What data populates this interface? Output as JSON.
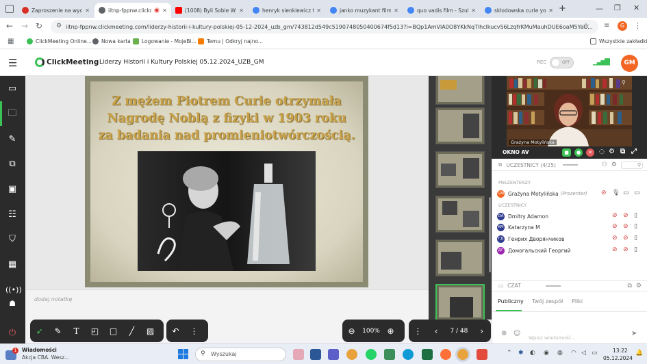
{
  "browser": {
    "tabs": [
      {
        "label": "Zaproszenie na wyda",
        "color": "#d93025"
      },
      {
        "label": "iitnp-fppnw.clickm",
        "color": "#5f6368"
      },
      {
        "label": "(1008) Byli Sobie Wyn",
        "color": "#ff0000"
      },
      {
        "label": "henryk sienkiewicz fi",
        "color": "#4285f4"
      },
      {
        "label": "janko muzykant film",
        "color": "#4285f4"
      },
      {
        "label": "quo vadis film - Szuk",
        "color": "#4285f4"
      },
      {
        "label": "skłodowska curie yo",
        "color": "#4285f4"
      }
    ],
    "new_tab": "+",
    "url": "iitnp-fppnw.clickmeeting.com/liderzy-historii-i-kultury-polskiej-05-12-2024_uzb_gm/743812d549c51907480504​00674f5d13?l=BQp1AmVlA0O8YKkNqTlhclkucv56LzqfrKMuMauhDUE6oaM5YaO...",
    "profile": "G",
    "bookmarks": [
      {
        "label": "ClickMeeting Online...",
        "color": "#3cc156"
      },
      {
        "label": "Nowa karta",
        "color": "#5f6368"
      },
      {
        "label": "Logowanie - MojeBi...",
        "color": "#6ab04c"
      },
      {
        "label": "Temu | Odkryj najno...",
        "color": "#f57c00"
      }
    ],
    "all_bookmarks": "Wszystkie zakładki"
  },
  "app": {
    "logo": "ClickMeeting",
    "title": "Liderzy Historii i Kultury Polskiej 05.12.2024_UZB_GM",
    "rec": "REC",
    "toggle": "OFF",
    "user_initials": "GM"
  },
  "slide": {
    "lines": [
      "Z mężem Piotrem Curie otrzymała",
      "Nagrodę Noblą z fizyki w 1903 roku",
      "za badania nad promieniotwórczością."
    ]
  },
  "notes": {
    "placeholder": "dodaj notatkę"
  },
  "toolbar": {
    "zoom": "100%",
    "page": "7 / 48"
  },
  "video": {
    "name": "Grażyna Motylińska",
    "okno": "OKNO AV"
  },
  "participants": {
    "header": "UCZESTNICY (4/25)",
    "presenters_label": "PREZENTERZY",
    "presenter": {
      "name": "Grażyna Motylińska",
      "role": "(Prezenter)",
      "initials": "GM",
      "color": "#f26522"
    },
    "attendees_label": "UCZESTNICY",
    "attendees": [
      {
        "name": "Dmitry Adamon",
        "initials": "DA",
        "color": "#2f3c8f"
      },
      {
        "name": "Katarzyna M",
        "initials": "KM",
        "color": "#2f3c8f"
      },
      {
        "name": "Генрих Дворянчиков",
        "initials": "ГД",
        "color": "#2f3c8f"
      },
      {
        "name": "Домогальский Георгий",
        "initials": "ДГ",
        "color": "#9c27b0"
      }
    ]
  },
  "chat": {
    "header": "CZAT",
    "tabs": [
      "Publiczny",
      "Twój zespół",
      "Pliki"
    ],
    "placeholder": "Wpisz wiadomość..."
  },
  "taskbar": {
    "notification_title": "Wiadomości",
    "notification_text": "Akcja CBA. Wesz...",
    "badge": "1",
    "search": "Wyszukaj",
    "time": "13:22",
    "date": "05.12.2024"
  }
}
